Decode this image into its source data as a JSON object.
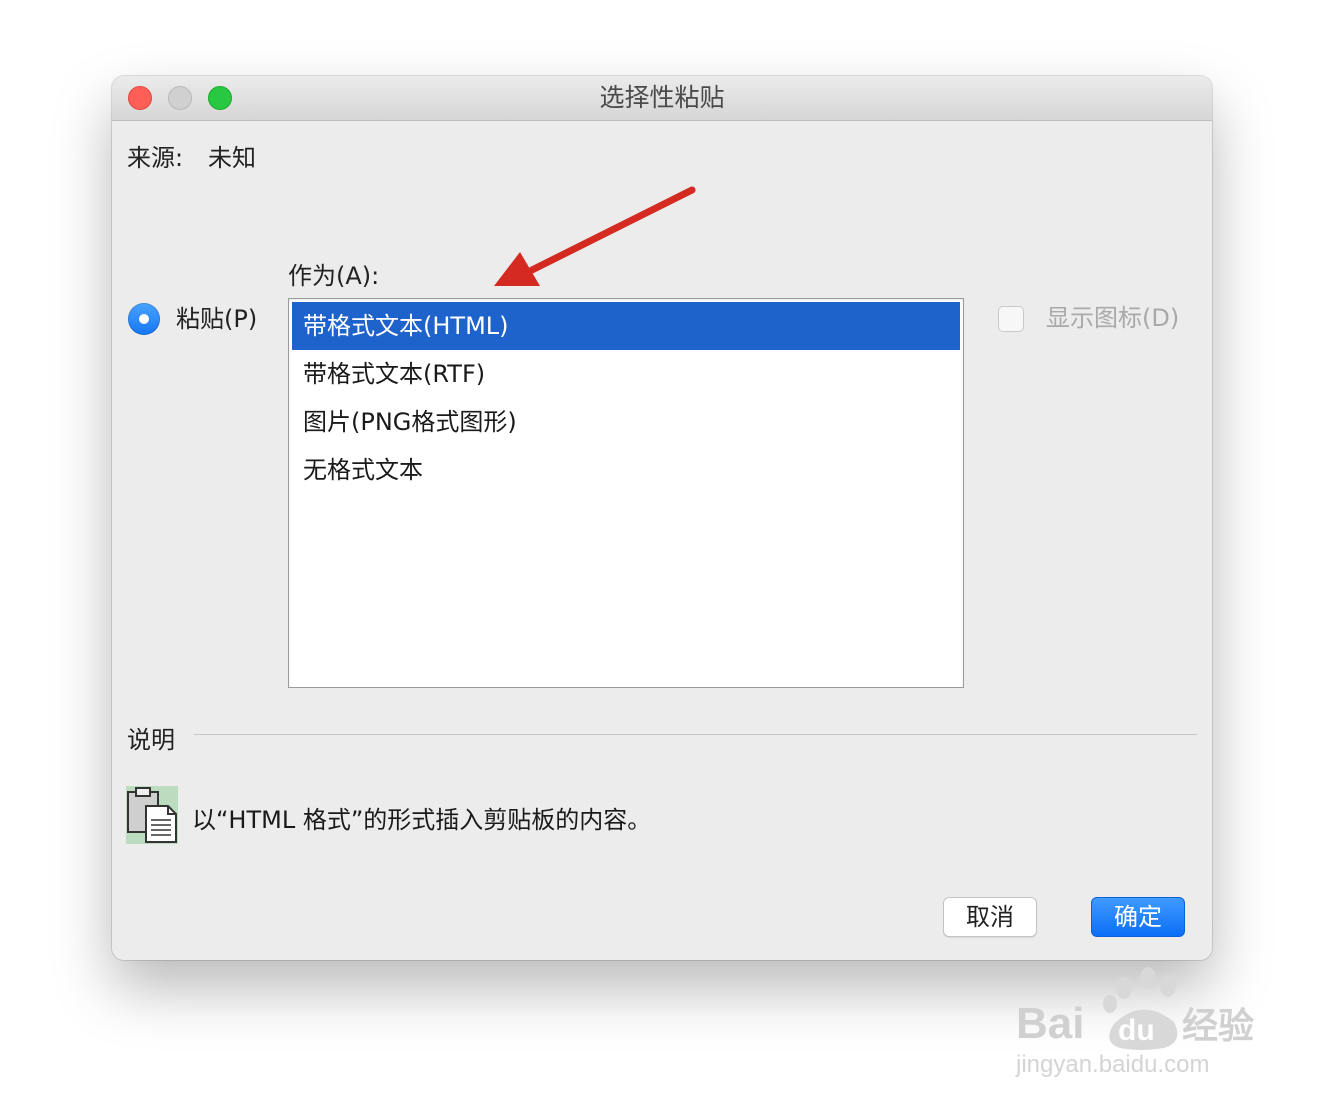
{
  "window": {
    "title": "选择性粘贴"
  },
  "source": {
    "label": "来源:",
    "value": "未知"
  },
  "paste_as": {
    "label": "作为(A):",
    "options": [
      {
        "label": "带格式文本(HTML)",
        "selected": true
      },
      {
        "label": "带格式文本(RTF)",
        "selected": false
      },
      {
        "label": "图片(PNG格式图形)",
        "selected": false
      },
      {
        "label": "无格式文本",
        "selected": false
      }
    ]
  },
  "paste_radio": {
    "label": "粘贴(P)",
    "checked": true
  },
  "display_icon": {
    "label": "显示图标(D)",
    "checked": false,
    "enabled": false
  },
  "description": {
    "heading": "说明",
    "icon": "clipboard-document-icon",
    "text": "以“HTML 格式”的形式插入剪贴板的内容。"
  },
  "buttons": {
    "cancel": "取消",
    "ok": "确定"
  },
  "watermark": {
    "brand_latin": "Bai",
    "brand_latin2": "du",
    "brand_cn": "经验",
    "url": "jingyan.baidu.com"
  },
  "colors": {
    "accent": "#1576f5",
    "selection": "#1e62cc",
    "annotation_arrow": "#d42a22"
  }
}
